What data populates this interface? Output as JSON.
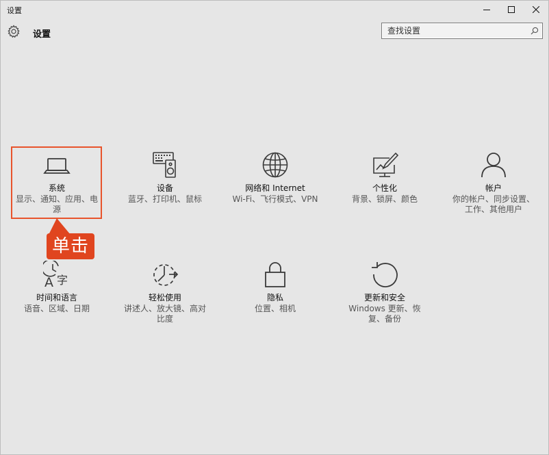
{
  "window": {
    "title": "设置"
  },
  "header": {
    "app_name": "设置",
    "gear_icon": "gear-icon",
    "search_placeholder": "查找设置",
    "search_value": "",
    "search_icon": "search-icon"
  },
  "categories": [
    {
      "icon": "laptop-icon",
      "title": "系统",
      "desc": "显示、通知、应用、电源"
    },
    {
      "icon": "keyboard-speaker-icon",
      "title": "设备",
      "desc": "蓝牙、打印机、鼠标"
    },
    {
      "icon": "globe-icon",
      "title": "网络和 Internet",
      "desc": "Wi-Fi、飞行模式、VPN"
    },
    {
      "icon": "paint-icon",
      "title": "个性化",
      "desc": "背景、锁屏、颜色"
    },
    {
      "icon": "person-icon",
      "title": "帐户",
      "desc": "你的帐户、同步设置、工作、其他用户"
    },
    {
      "icon": "time-language-icon",
      "title": "时间和语言",
      "desc": "语音、区域、日期"
    },
    {
      "icon": "ease-of-access-icon",
      "title": "轻松使用",
      "desc": "讲述人、放大镜、高对比度"
    },
    {
      "icon": "lock-icon",
      "title": "隐私",
      "desc": "位置、相机"
    },
    {
      "icon": "update-icon",
      "title": "更新和安全",
      "desc": "Windows 更新、恢复、备份"
    }
  ],
  "annotation": {
    "callout_text": "单击",
    "color": "#e0451f"
  },
  "colors": {
    "background": "#e6e6e6",
    "icon": "#3a3a3a",
    "accent": "#e0451f"
  }
}
